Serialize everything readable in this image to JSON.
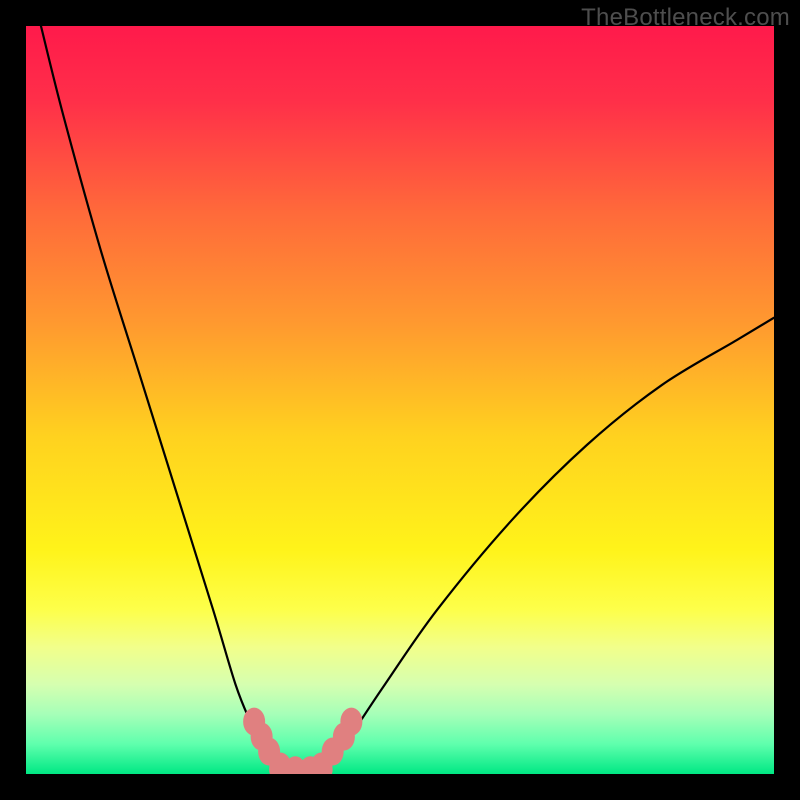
{
  "watermark": "TheBottleneck.com",
  "chart_data": {
    "type": "line",
    "title": "",
    "xlabel": "",
    "ylabel": "",
    "xlim": [
      0,
      100
    ],
    "ylim": [
      0,
      100
    ],
    "series": [
      {
        "name": "bottleneck-curve",
        "x": [
          2,
          5,
          10,
          15,
          20,
          25,
          28,
          30,
          32,
          34,
          35,
          36,
          38,
          40,
          42,
          44,
          48,
          55,
          65,
          75,
          85,
          95,
          100
        ],
        "y": [
          100,
          88,
          70,
          54,
          38,
          22,
          12,
          7,
          3,
          1,
          0,
          0,
          0,
          1,
          3,
          6,
          12,
          22,
          34,
          44,
          52,
          58,
          61
        ]
      }
    ],
    "markers": {
      "name": "highlight-band",
      "x": [
        30.5,
        31.5,
        32.5,
        34,
        36,
        38,
        39.5,
        41,
        42.5,
        43.5
      ],
      "y": [
        7,
        5,
        3,
        1,
        0.5,
        0.5,
        1,
        3,
        5,
        7
      ]
    },
    "gradient_stops": [
      {
        "offset": 0.0,
        "color": "#ff1a4b"
      },
      {
        "offset": 0.1,
        "color": "#ff2f49"
      },
      {
        "offset": 0.25,
        "color": "#ff6a3a"
      },
      {
        "offset": 0.4,
        "color": "#ff9a2f"
      },
      {
        "offset": 0.55,
        "color": "#ffd21f"
      },
      {
        "offset": 0.7,
        "color": "#fff31a"
      },
      {
        "offset": 0.78,
        "color": "#fdff4a"
      },
      {
        "offset": 0.83,
        "color": "#f2ff8a"
      },
      {
        "offset": 0.88,
        "color": "#d6ffb0"
      },
      {
        "offset": 0.92,
        "color": "#a6ffb8"
      },
      {
        "offset": 0.96,
        "color": "#5fffad"
      },
      {
        "offset": 1.0,
        "color": "#00e884"
      }
    ]
  }
}
